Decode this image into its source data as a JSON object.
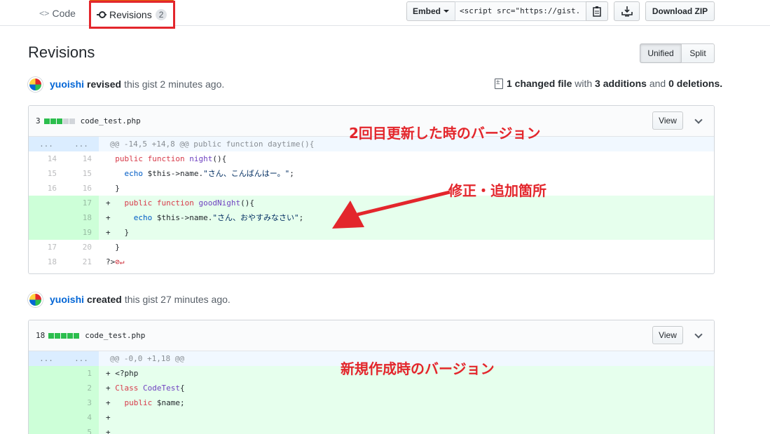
{
  "tabs": {
    "code": {
      "label": "Code",
      "icon": "code-icon"
    },
    "revisions": {
      "label": "Revisions",
      "count": "2",
      "icon": "revisions-icon"
    }
  },
  "toolbar": {
    "embed_label": "Embed",
    "embed_value": "<script src=\"https://gist.",
    "copy_icon": "clipboard-icon",
    "download_icon": "desktop-download-icon",
    "download_zip_label": "Download ZIP"
  },
  "page": {
    "title": "Revisions",
    "unified_label": "Unified",
    "split_label": "Split"
  },
  "revision1": {
    "user": "yuoishi",
    "verb": "revised",
    "text": "this gist 2 minutes ago.",
    "summary": {
      "changed": "1 changed file",
      "with": "with",
      "additions": "3 additions",
      "and": "and",
      "deletions": "0 deletions."
    },
    "file": {
      "count": "3",
      "name": "code_test.php",
      "view_label": "View",
      "hunk": "@@ -14,5 +14,8 @@ public function daytime(){"
    }
  },
  "revision2": {
    "user": "yuoishi",
    "verb": "created",
    "text": "this gist 27 minutes ago.",
    "file": {
      "count": "18",
      "name": "code_test.php",
      "view_label": "View",
      "hunk": "@@ -0,0 +1,18 @@"
    }
  },
  "annotations": {
    "second_update": "2回目更新した時のバージョン",
    "fix_added": "修正・追加箇所",
    "new_version": "新規作成時のバージョン"
  },
  "colors": {
    "annotation_red": "#e3262c",
    "add_bg": "#e6ffed",
    "hunk_bg": "#f1f8ff",
    "link_blue": "#0366d6"
  }
}
